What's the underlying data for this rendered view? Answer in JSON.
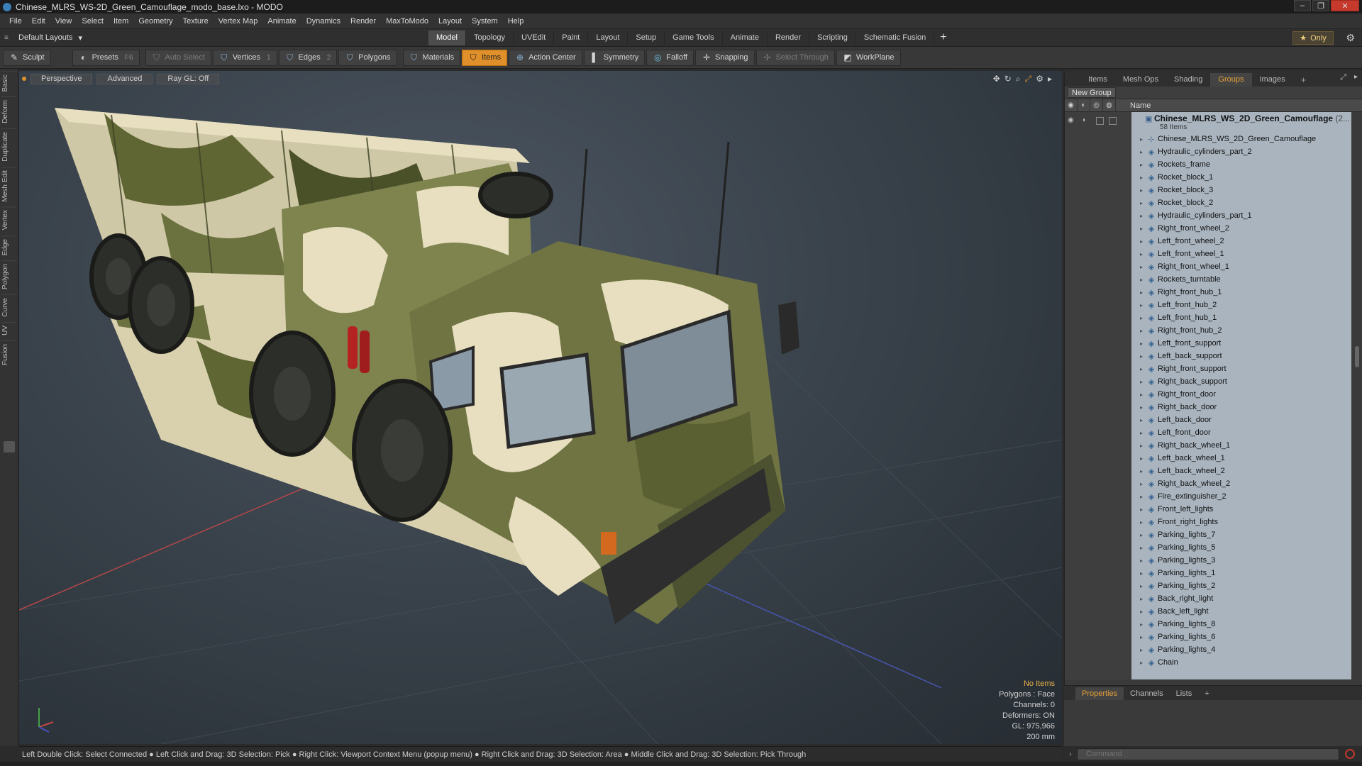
{
  "window": {
    "title": "Chinese_MLRS_WS-2D_Green_Camouflage_modo_base.lxo - MODO",
    "controls": [
      "–",
      "❐",
      "✕"
    ]
  },
  "menu": [
    "File",
    "Edit",
    "View",
    "Select",
    "Item",
    "Geometry",
    "Texture",
    "Vertex Map",
    "Animate",
    "Dynamics",
    "Render",
    "MaxToModo",
    "Layout",
    "System",
    "Help"
  ],
  "layout": {
    "selector": "Default Layouts",
    "tabs": [
      "Model",
      "Topology",
      "UVEdit",
      "Paint",
      "Layout",
      "Setup",
      "Game Tools",
      "Animate",
      "Render",
      "Scripting",
      "Schematic Fusion"
    ],
    "active_tab": "Model",
    "only_label": "Only"
  },
  "toolbar": {
    "sculpt": "Sculpt",
    "presets": "Presets",
    "presets_key": "F6",
    "auto_select": "Auto Select",
    "vertices": "Vertices",
    "vertices_key": "1",
    "edges": "Edges",
    "edges_key": "2",
    "polygons": "Polygons",
    "materials": "Materials",
    "items": "Items",
    "action_center": "Action Center",
    "symmetry": "Symmetry",
    "falloff": "Falloff",
    "snapping": "Snapping",
    "select_through": "Select Through",
    "workplane": "WorkPlane"
  },
  "left_tabs": [
    "Basic",
    "Deform",
    "Duplicate",
    "Mesh Edit",
    "Vertex",
    "Edge",
    "Polygon",
    "Curve",
    "UV",
    "Fusion"
  ],
  "viewport": {
    "view": "Perspective",
    "shading": "Advanced",
    "raygl": "Ray GL: Off",
    "info": {
      "items": "No Items",
      "polygons": "Polygons : Face",
      "channels": "Channels: 0",
      "deformers": "Deformers: ON",
      "gl": "GL: 975,966",
      "scale": "200 mm"
    }
  },
  "status": "Left Double Click: Select Connected ● Left Click and Drag: 3D Selection: Pick ● Right Click: Viewport Context Menu (popup menu) ● Right Click and Drag: 3D Selection: Area ● Middle Click and Drag: 3D Selection: Pick Through",
  "right_panel": {
    "tabs": [
      "Items",
      "Mesh Ops",
      "Shading",
      "Groups",
      "Images"
    ],
    "active_tab": "Groups",
    "new_group": "New Group",
    "name_header": "Name",
    "group": {
      "name": "Chinese_MLRS_WS_2D_Green_Camouflage",
      "name_suffix": "(2...",
      "count": "58 Items"
    },
    "items": [
      "Chinese_MLRS_WS_2D_Green_Camouflage",
      "Hydraulic_cylinders_part_2",
      "Rockets_frame",
      "Rocket_block_1",
      "Rocket_block_3",
      "Rocket_block_2",
      "Hydraulic_cylinders_part_1",
      "Right_front_wheel_2",
      "Left_front_wheel_2",
      "Left_front_wheel_1",
      "Right_front_wheel_1",
      "Rockets_turntable",
      "Right_front_hub_1",
      "Left_front_hub_2",
      "Left_front_hub_1",
      "Right_front_hub_2",
      "Left_front_support",
      "Left_back_support",
      "Right_front_support",
      "Right_back_support",
      "Right_front_door",
      "Right_back_door",
      "Left_back_door",
      "Left_front_door",
      "Right_back_wheel_1",
      "Left_back_wheel_1",
      "Left_back_wheel_2",
      "Right_back_wheel_2",
      "Fire_extinguisher_2",
      "Front_left_lights",
      "Front_right_lights",
      "Parking_lights_7",
      "Parking_lights_5",
      "Parking_lights_3",
      "Parking_lights_1",
      "Parking_lights_2",
      "Back_right_light",
      "Back_left_light",
      "Parking_lights_8",
      "Parking_lights_6",
      "Parking_lights_4",
      "Chain"
    ]
  },
  "properties_panel": {
    "tabs": [
      "Properties",
      "Channels",
      "Lists"
    ],
    "active_tab": "Properties"
  },
  "command": {
    "placeholder": "Command"
  },
  "colors": {
    "accent": "#e0902a",
    "tab_active_text": "#e8a33a",
    "list_bg": "#a9b4bf",
    "camo_dark": "#5f6634",
    "camo_light": "#e7dfc0"
  }
}
